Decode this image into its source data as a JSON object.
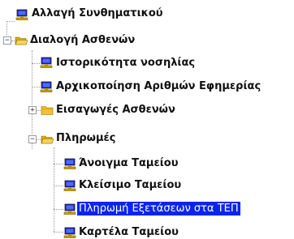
{
  "tree": {
    "root": [
      {
        "label": "Αλλαγή Συνθηματικού",
        "icon": "terminal-computer-icon"
      },
      {
        "label": "Διαλογή Ασθενών",
        "icon": "folder-open-icon",
        "expanded": true,
        "children": [
          {
            "label": "Ιστορικότητα νοσηλίας",
            "icon": "terminal-computer-icon"
          },
          {
            "label": "Αρχικοποίηση Αριθμών Εφημερίας",
            "icon": "terminal-computer-icon"
          },
          {
            "label": "Εισαγωγές Ασθενών",
            "icon": "folder-closed-icon",
            "expanded": false
          },
          {
            "label": "Πληρωμές",
            "icon": "folder-open-icon",
            "expanded": true,
            "children": [
              {
                "label": "Άνοιγμα Ταμείου",
                "icon": "terminal-computer-icon"
              },
              {
                "label": "Κλείσιμο Ταμείου",
                "icon": "terminal-computer-icon"
              },
              {
                "label": "Πληρωμή Εξετάσεων στα ΤΕΠ",
                "icon": "terminal-computer-icon",
                "selected": true
              },
              {
                "label": "Καρτέλα Ταμείου",
                "icon": "terminal-computer-icon"
              }
            ]
          }
        ]
      }
    ]
  },
  "expander_symbols": {
    "collapsed": "+",
    "expanded": "−"
  },
  "colors": {
    "selection_bg": "#0a24f0",
    "selection_text": "#ffffff",
    "folder": "#f1c232",
    "computer_screen": "#1a1ad0",
    "computer_base": "#c8a000"
  }
}
